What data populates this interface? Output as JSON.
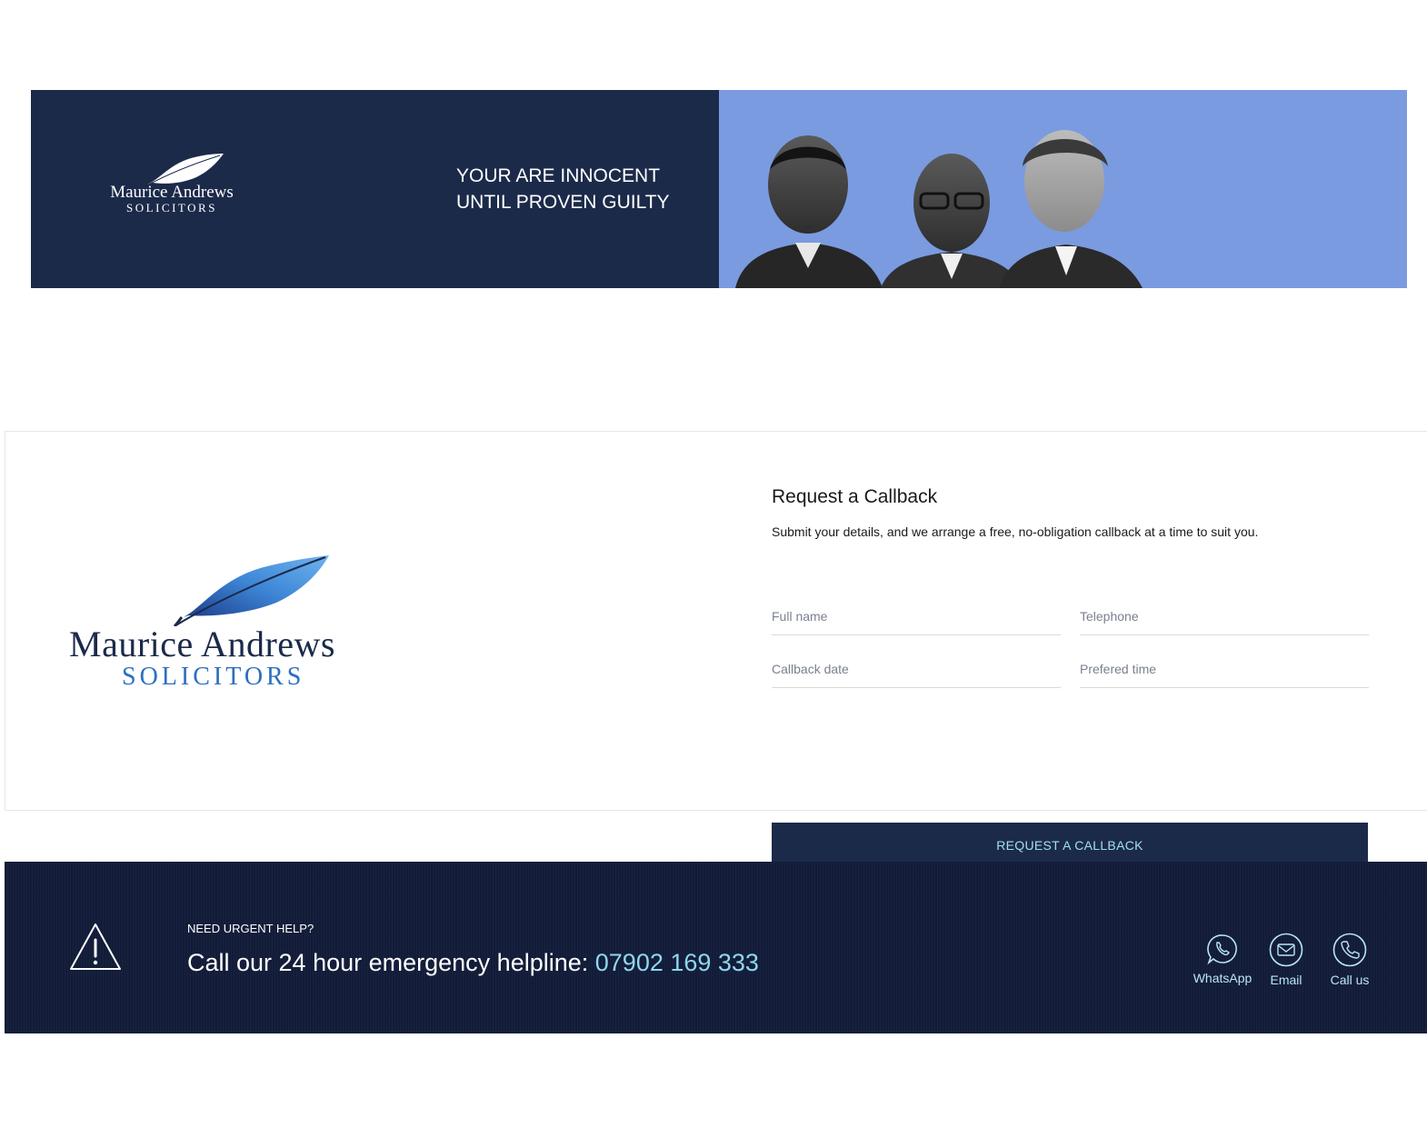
{
  "banner": {
    "logo": {
      "name": "Maurice Andrews",
      "sub": "SOLICITORS"
    },
    "slogan_line1": "YOUR ARE INNOCENT",
    "slogan_line2": "UNTIL PROVEN GUILTY"
  },
  "callback": {
    "logo": {
      "name": "Maurice Andrews",
      "sub": "SOLICITORS"
    },
    "title": "Request a Callback",
    "description": "Submit your details, and we arrange a free, no-obligation callback at a time to suit you.",
    "fields": {
      "full_name": {
        "placeholder": "Full name",
        "value": ""
      },
      "telephone": {
        "placeholder": "Telephone",
        "value": ""
      },
      "callback_date": {
        "placeholder": "Callback date",
        "value": ""
      },
      "preferred_time": {
        "placeholder": "Prefered time",
        "value": ""
      }
    },
    "submit_label": "REQUEST A CALLBACK"
  },
  "footer": {
    "urgent_label": "NEED URGENT HELP?",
    "helpline_text": "Call our 24 hour emergency helpline: ",
    "helpline_phone": "07902 169 333",
    "contacts": [
      {
        "label": "WhatsApp",
        "icon": "whatsapp-icon"
      },
      {
        "label": "Email",
        "icon": "email-icon"
      },
      {
        "label": "Call us",
        "icon": "phone-icon"
      }
    ]
  },
  "colors": {
    "navy": "#1c2a4a",
    "banner_blue": "#7a9be0",
    "footer_navy": "#121c38",
    "accent_cyan": "#8fd6ee",
    "logo_blue": "#2d6fc0"
  }
}
